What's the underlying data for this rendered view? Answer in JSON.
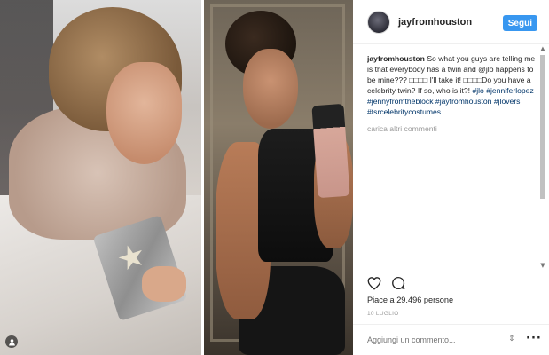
{
  "header": {
    "username": "jayfromhouston",
    "follow_label": "Segui"
  },
  "post": {
    "author": "jayfromhouston",
    "caption": "So what you guys are telling me is that everybody has a twin and @jlo happens to be mine??? □□□□ I'll take it! □□□□Do you have a celebrity twin? If so, who is it?!",
    "hashtags": [
      "#jlo",
      "#jenniferlopez",
      "#jennyfromtheblock",
      "#jayfromhouston",
      "#jlovers",
      "#tsrcelebritycostumes"
    ],
    "load_more_label": "carica altri commenti"
  },
  "stats": {
    "likes_label": "Piace a 29.496 persone",
    "date_label": "10 LUGLIO"
  },
  "comment_box": {
    "placeholder": "Aggiungi un commento..."
  },
  "icons": {
    "like": "heart-icon",
    "comment": "speech-bubble-icon",
    "more": "ellipsis-icon",
    "tag": "user-tag-icon",
    "scroll": "up-down-arrows-icon"
  },
  "colors": {
    "accent": "#3897f0",
    "hashtag": "#003569",
    "muted": "#999999"
  }
}
